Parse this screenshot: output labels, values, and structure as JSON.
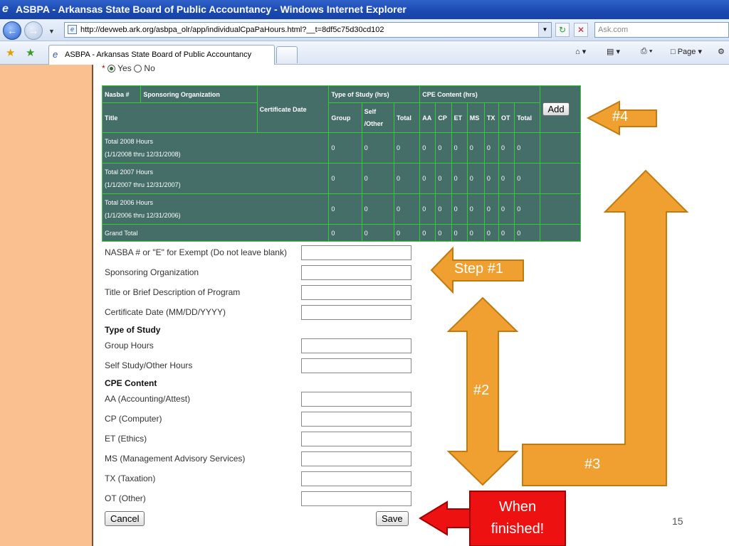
{
  "window": {
    "title": "ASBPA - Arkansas State Board of Public Accountancy - Windows Internet Explorer"
  },
  "browser": {
    "url": "http://devweb.ark.org/asbpa_olr/app/individualCpaPaHours.html?__t=8df5c75d30cd102",
    "search_placeholder": "Ask.com",
    "tab_title": "ASBPA - Arkansas State Board of Public Accountancy",
    "page_menu": "Page"
  },
  "form_top": {
    "yes": "Yes",
    "no": "No",
    "selected": "Yes"
  },
  "hours_table": {
    "headers": {
      "nasba": "Nasba #",
      "sponsoring": "Sponsoring Organization",
      "certificate_date": "Certificate Date",
      "type_of_study": "Type of Study (hrs)",
      "cpe_content": "CPE Content (hrs)",
      "title": "Title",
      "group": "Group",
      "self_other": "Self /Other",
      "total": "Total",
      "aa": "AA",
      "cp": "CP",
      "et": "ET",
      "ms": "MS",
      "tx": "TX",
      "ot": "OT",
      "cpe_total": "Total"
    },
    "add_label": "Add",
    "rows": [
      {
        "label": "Total 2008 Hours",
        "sub": "(1/1/2008 thru 12/31/2008)",
        "values": [
          "0",
          "0",
          "0",
          "0",
          "0",
          "0",
          "0",
          "0",
          "0",
          "0"
        ]
      },
      {
        "label": "Total 2007 Hours",
        "sub": "(1/1/2007 thru 12/31/2007)",
        "values": [
          "0",
          "0",
          "0",
          "0",
          "0",
          "0",
          "0",
          "0",
          "0",
          "0"
        ]
      },
      {
        "label": "Total 2006 Hours",
        "sub": "(1/1/2006 thru 12/31/2006)",
        "values": [
          "0",
          "0",
          "0",
          "0",
          "0",
          "0",
          "0",
          "0",
          "0",
          "0"
        ]
      }
    ],
    "grand_total": {
      "label": "Grand Total",
      "values": [
        "0",
        "0",
        "0",
        "0",
        "0",
        "0",
        "0",
        "0",
        "0",
        "0"
      ]
    }
  },
  "entry_form": {
    "nasba": "NASBA # or \"E\" for Exempt (Do not leave blank)",
    "sponsoring": "Sponsoring Organization",
    "title": "Title or Brief Description of Program",
    "cert_date": "Certificate Date (MM/DD/YYYY)",
    "type_of_study_heading": "Type of Study",
    "group_hours": "Group Hours",
    "self_study": "Self Study/Other Hours",
    "cpe_heading": "CPE Content",
    "aa": "AA (Accounting/Attest)",
    "cp": "CP (Computer)",
    "et": "ET (Ethics)",
    "ms": "MS (Management Advisory Services)",
    "tx": "TX (Taxation)",
    "ot": "OT (Other)",
    "cancel": "Cancel",
    "save": "Save"
  },
  "annotations": {
    "step1": "Step #1",
    "step2": "#2",
    "step3": "#3",
    "step4": "#4",
    "finished_line1": "When",
    "finished_line2": "finished!",
    "arrow_color": "#f0a030",
    "finished_color": "#ee1111"
  },
  "slide": {
    "page_number": "15"
  }
}
